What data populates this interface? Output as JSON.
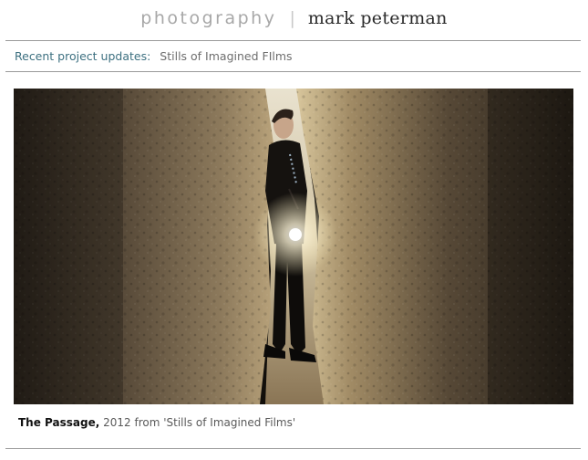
{
  "header": {
    "section_label": "photography",
    "separator": "|",
    "photographer_name": "mark peterman"
  },
  "updates": {
    "label": "Recent project updates:",
    "link_text": "Stills of Imagined FIlms"
  },
  "photo": {
    "description_icon": "photo-the-passage"
  },
  "caption": {
    "title": "The Passage,",
    "details": " 2012 from 'Stills of Imagined Films'"
  },
  "colors": {
    "accent": "#3d7080",
    "rule": "#9a9a9a"
  }
}
